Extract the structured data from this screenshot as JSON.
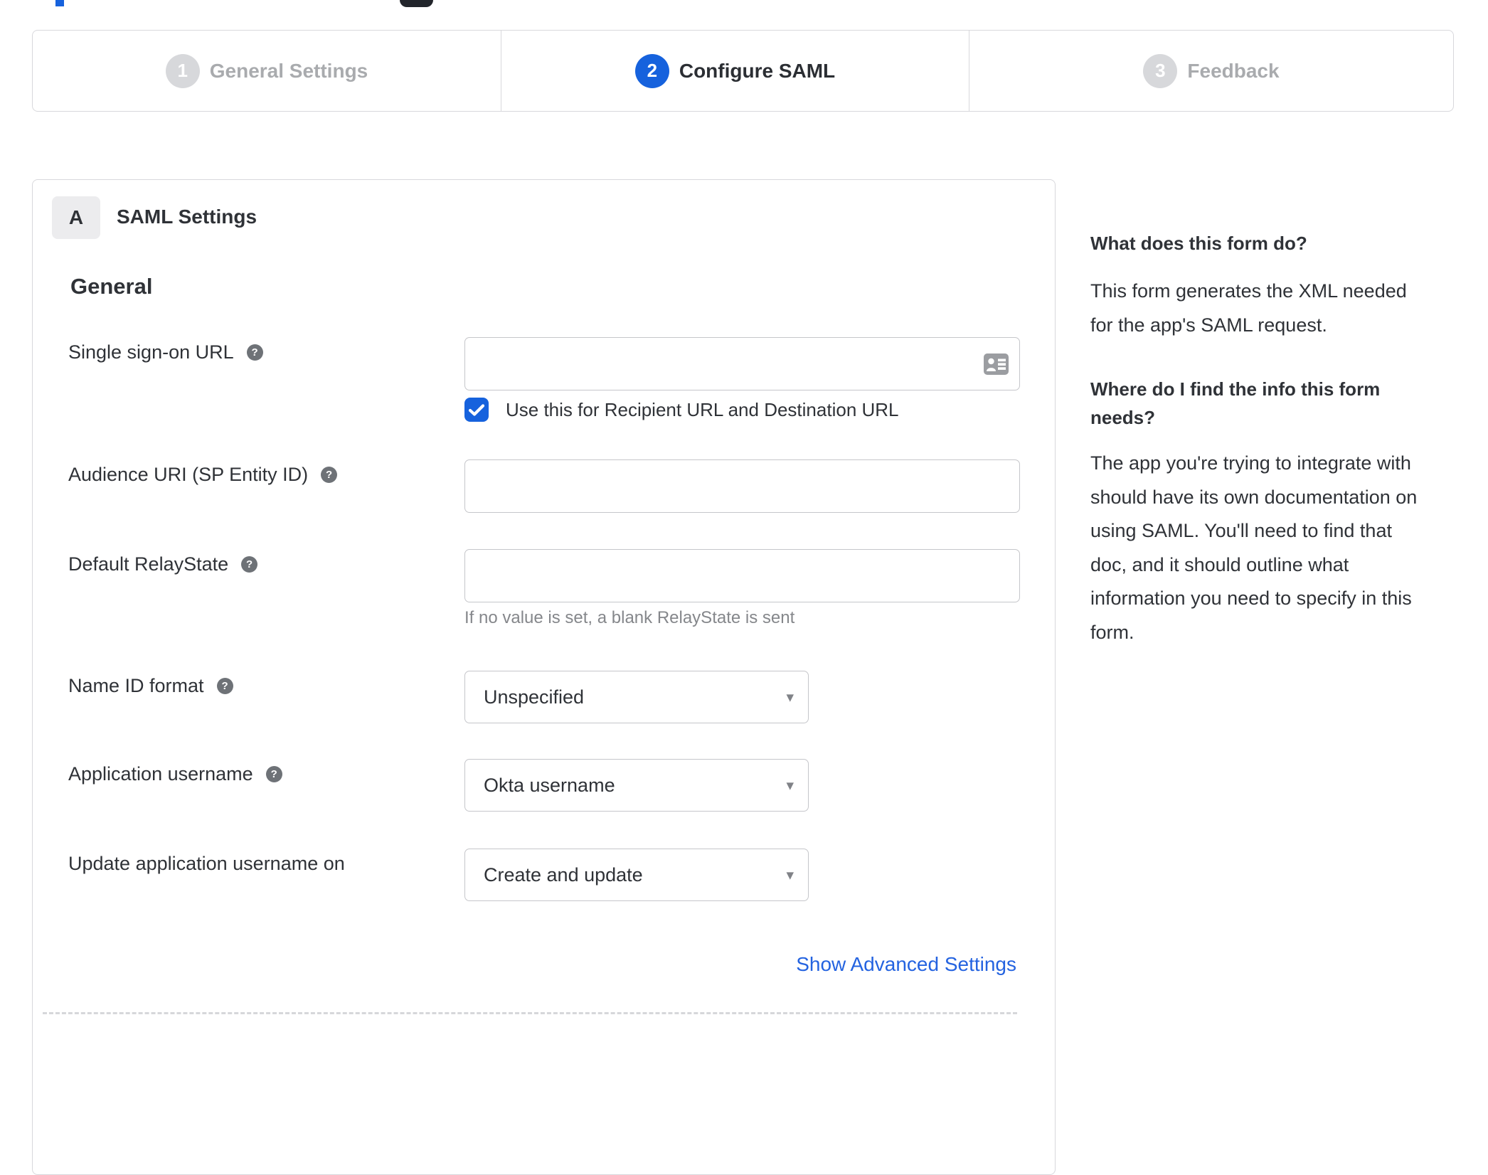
{
  "stepper": {
    "steps": [
      {
        "number": "1",
        "label": "General Settings",
        "state": "inactive"
      },
      {
        "number": "2",
        "label": "Configure SAML",
        "state": "active"
      },
      {
        "number": "3",
        "label": "Feedback",
        "state": "inactive"
      }
    ]
  },
  "panel": {
    "badge": "A",
    "title": "SAML Settings",
    "section_heading": "General"
  },
  "form": {
    "rows": [
      {
        "label": "Single sign-on URL",
        "type": "text",
        "value": "",
        "checkbox_label": "Use this for Recipient URL and Destination URL",
        "checkbox_checked": true
      },
      {
        "label": "Audience URI (SP Entity ID)",
        "type": "text",
        "value": ""
      },
      {
        "label": "Default RelayState",
        "type": "text",
        "value": "",
        "hint": "If no value is set, a blank RelayState is sent"
      },
      {
        "label": "Name ID format",
        "type": "select",
        "value": "Unspecified"
      },
      {
        "label": "Application username",
        "type": "select",
        "value": "Okta username"
      },
      {
        "label": "Update application username on",
        "type": "select",
        "value": "Create and update"
      }
    ],
    "advanced_link": "Show Advanced Settings"
  },
  "sidebar": {
    "sections": [
      {
        "heading": "What does this form do?",
        "body": "This form generates the XML needed\nfor the app's SAML request."
      },
      {
        "heading": "Where do I find the info this form\nneeds?",
        "body": "The app you're trying to integrate with\nshould have its own documentation on\nusing SAML. You'll need to find that\ndoc, and it should outline what\ninformation you need to specify in this\nform."
      }
    ]
  },
  "colors": {
    "accent_blue": "#1662dd",
    "link_blue": "#2463e0",
    "border_gray": "#d8d8dc",
    "input_border": "#c5c6ca",
    "muted_text": "#85878b",
    "inactive_step": "#a9abae"
  }
}
